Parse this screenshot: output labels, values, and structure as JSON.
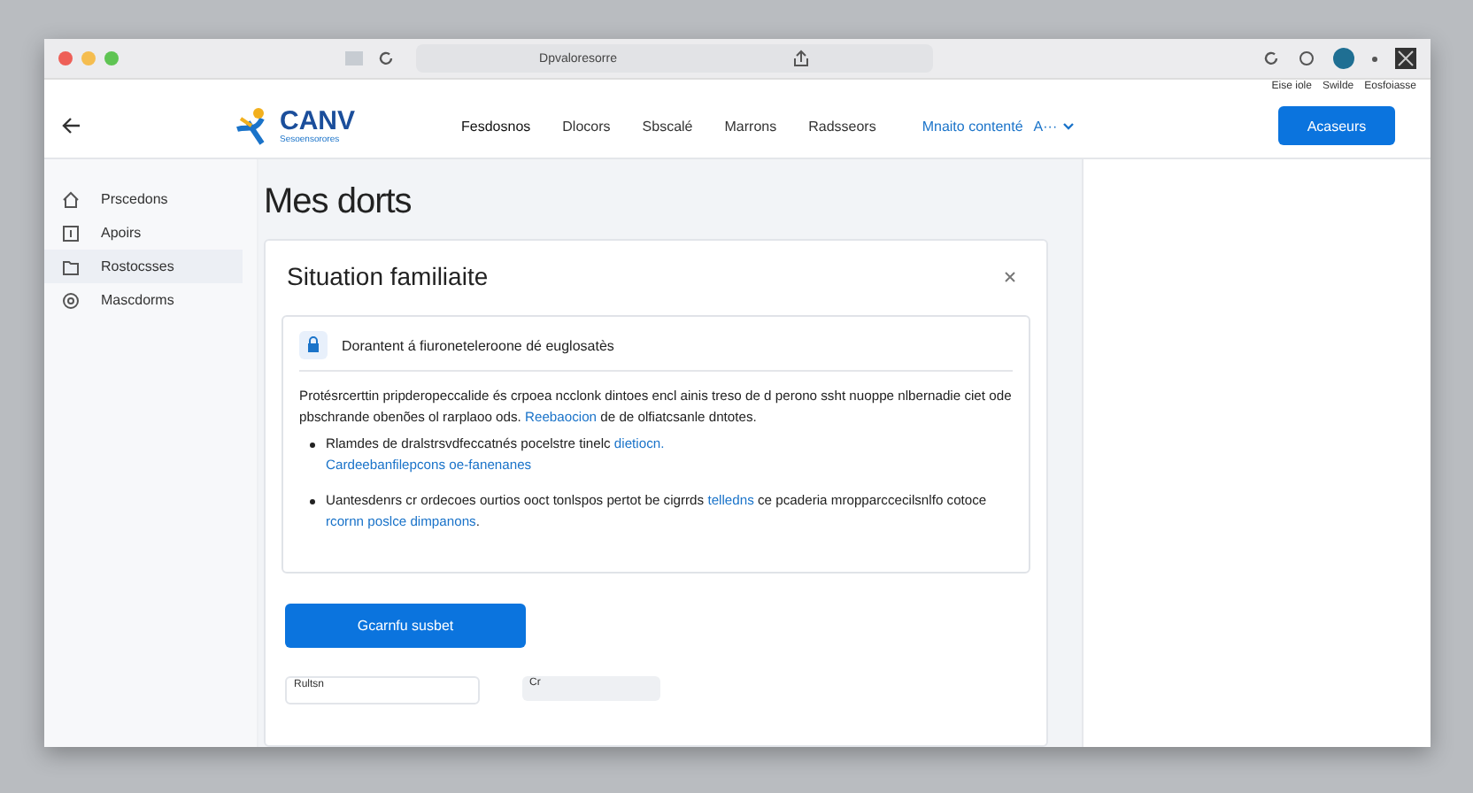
{
  "window": {
    "url": "Dpvaloresorre"
  },
  "top_links": [
    "Eise iole",
    "Swilde",
    "Eosfoiasse"
  ],
  "header": {
    "logo": "CANV",
    "logo_subtitle": "Sesoensorores",
    "nav": [
      {
        "label": "Fesdosnos",
        "selected": true
      },
      {
        "label": "Dlocors",
        "selected": false
      },
      {
        "label": "Sbscalé",
        "selected": false
      },
      {
        "label": "Marrons",
        "selected": false
      },
      {
        "label": "Radsseors",
        "selected": false
      }
    ],
    "contact_link": "Mnaito contenté",
    "language": "A···",
    "action_button": "Acaseurs"
  },
  "sidebar": {
    "items": [
      {
        "label": "Prscedons",
        "kind": "home",
        "selected": false
      },
      {
        "label": "Apoirs",
        "kind": "book",
        "selected": false
      },
      {
        "label": "Rostocsses",
        "kind": "folder",
        "selected": true
      },
      {
        "label": "Mascdorms",
        "kind": "circle",
        "selected": false
      }
    ]
  },
  "page_title": "Mes dorts",
  "card": {
    "title": "Situation familiaite",
    "notice": {
      "title": "Dorantent á fiuroneteleroone dé euglosatès",
      "paragraph": [
        {
          "text": "Protésrcerttin pripderopeccalide és crpoea ncclonk dintoes encl ainis treso de d perono ssht nuoppe nlbernadie ciet ode pbschrande obenões ol rarplaoo ods. "
        },
        {
          "text": "Reebaocion",
          "link": true
        },
        {
          "text": " de de olfiatcsanle dntotes."
        }
      ],
      "bullets": [
        {
          "parts": [
            {
              "text": "Rlamdes de dralstrsvdfeccatnés pocelstre tinelc "
            },
            {
              "text": "dietiocn.",
              "link": true
            }
          ],
          "sub_link": "Cardeebanfilepcons oe-fanenanes"
        },
        {
          "parts": [
            {
              "text": "Uantesdenrs cr ordecoes ourtios ooct tonlspos pertot be cigrrds "
            },
            {
              "text": "telledns",
              "link": true
            },
            {
              "text": " ce pcaderia mropparccecilsnlfo cotoce "
            },
            {
              "text": "rcornn poslce dimpanons",
              "link": true
            },
            {
              "text": "."
            }
          ]
        }
      ]
    },
    "submit_button": "Gcarnfu susbet",
    "bottom_items": [
      "Rultsn",
      "Cr"
    ]
  }
}
